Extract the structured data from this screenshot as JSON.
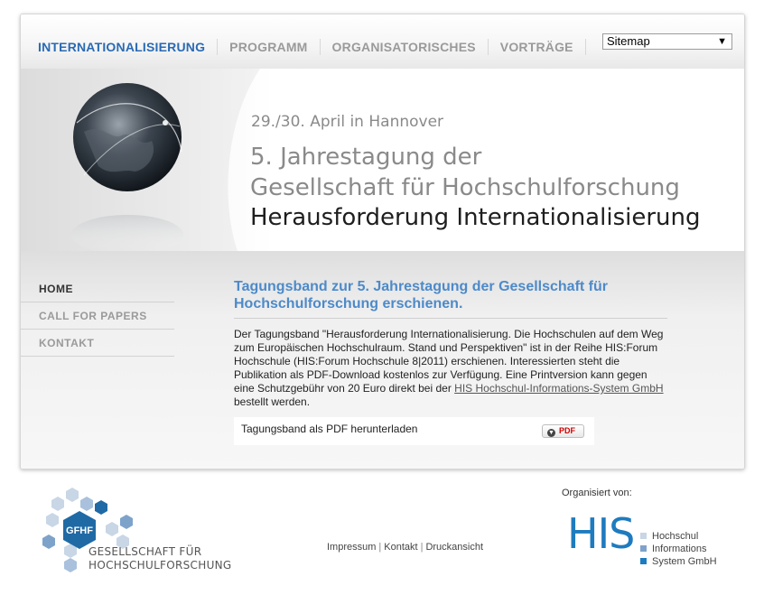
{
  "nav": {
    "items": [
      "INTERNATIONALISIERUNG",
      "PROGRAMM",
      "ORGANISATORISCHES",
      "VORTRÄGE"
    ],
    "sitemap_value": "Sitemap"
  },
  "hero": {
    "date": "29./30. April in Hannover",
    "line1": "5. Jahrestagung der",
    "line2": "Gesellschaft für Hochschulforschung",
    "line3": "Herausforderung Internationalisierung"
  },
  "sidebar": {
    "items": [
      "HOME",
      "CALL FOR PAPERS",
      "KONTAKT"
    ]
  },
  "article": {
    "title": "Tagungsband zur 5. Jahrestagung der Gesellschaft für Hochschulforschung erschienen.",
    "body_text": "Der Tagungsband \"Herausforderung Internationalisierung. Die Hochschulen auf dem Weg zum Europäischen Hochschulraum. Stand und Perspektiven\" ist in der Reihe HIS:Forum Hochschule (HIS:Forum Hochschule 8|2011) erschienen. Interessierten steht die Publikation als PDF-Download kostenlos zur Verfügung. Eine Printversion kann gegen eine Schutzgebühr von 20 Euro direkt bei der ",
    "link_text": "HIS Hochschul-Informations-System GmbH",
    "body_end": " bestellt werden.",
    "download_label": "Tagungsband als PDF herunterladen",
    "pdf_button": "PDF"
  },
  "footer": {
    "logo_badge": "GFHF",
    "logo_line1": "GESELLSCHAFT FÜR",
    "logo_line2": "HOCHSCHULFORSCHUNG",
    "links": [
      "Impressum",
      "Kontakt",
      "Druckansicht"
    ],
    "link_separator": "|",
    "organized_by": "Organisiert von:",
    "his_logo": "HIS",
    "his_items": [
      "Hochschul",
      "Informations",
      "System GmbH"
    ]
  },
  "colors": {
    "accent_blue": "#2a6ab3",
    "title_blue": "#4d8ac9",
    "his_blue": "#1e7bbf",
    "gfhf_blue": "#1f6aa5"
  }
}
